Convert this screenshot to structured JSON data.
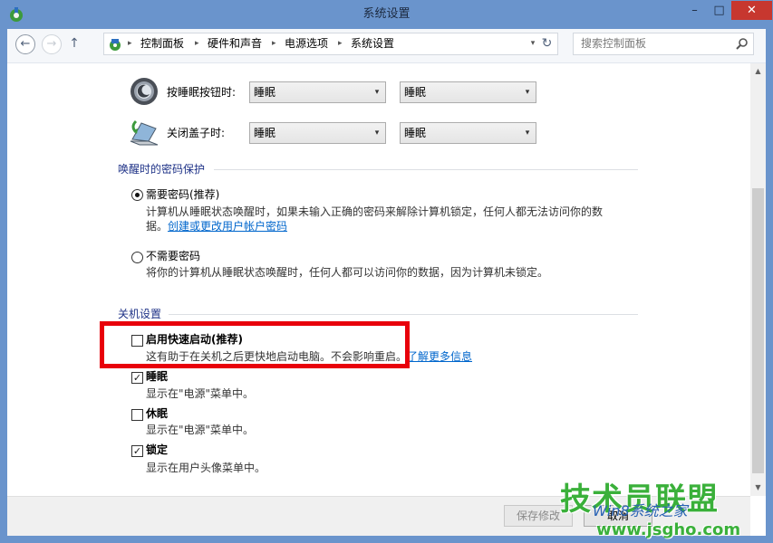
{
  "window": {
    "title": "系统设置",
    "controls": {
      "minimize": "–",
      "maximize": "□",
      "close": "✕"
    }
  },
  "nav": {
    "back_glyph": "←",
    "forward_glyph": "→",
    "up_glyph": "↑",
    "breadcrumb": [
      {
        "label": "控制面板"
      },
      {
        "label": "硬件和声音"
      },
      {
        "label": "电源选项"
      },
      {
        "label": "系统设置"
      }
    ],
    "separator": "▸",
    "dropdown_glyph": "▾",
    "refresh_glyph": "↻",
    "search": {
      "placeholder": "搜索控制面板"
    }
  },
  "power_buttons": [
    {
      "label": "按睡眠按钮时:",
      "battery_value": "睡眠",
      "plugged_value": "睡眠",
      "icon": "sleep-button-icon"
    },
    {
      "label": "关闭盖子时:",
      "battery_value": "睡眠",
      "plugged_value": "睡眠",
      "icon": "laptop-lid-icon"
    }
  ],
  "password": {
    "group_title": "唤醒时的密码保护",
    "require": {
      "label": "需要密码(推荐)",
      "desc": "计算机从睡眠状态唤醒时，如果未输入正确的密码来解除计算机锁定，任何人都无法访问你的数",
      "desc_line2": "据。",
      "link": "创建或更改用户帐户密码",
      "checked": true
    },
    "norequire": {
      "label": "不需要密码",
      "desc": "将你的计算机从睡眠状态唤醒时，任何人都可以访问你的数据，因为计算机未锁定。",
      "checked": false
    }
  },
  "shutdown": {
    "group_title": "关机设置",
    "items": [
      {
        "label": "启用快速启动(推荐)",
        "desc": "这有助于在关机之后更快地启动电脑。不会影响重启。",
        "link": "了解更多信息",
        "checked": false
      },
      {
        "label": "睡眠",
        "desc": "显示在\"电源\"菜单中。",
        "checked": true
      },
      {
        "label": "休眠",
        "desc": "显示在\"电源\"菜单中。",
        "checked": false
      },
      {
        "label": "锁定",
        "desc": "显示在用户头像菜单中。",
        "checked": true
      }
    ]
  },
  "footer": {
    "save_label": "保存修改",
    "cancel_label": "取消"
  },
  "watermark": {
    "main": "技术员联盟",
    "sub": "Win8系统之家",
    "url": "www.jsgho.com"
  },
  "colors": {
    "window_frame": "#6a94cc",
    "close_button": "#c7372f",
    "group_title": "#1e3287",
    "link": "#0066cc",
    "highlight_box": "#e8000b",
    "watermark_green": "#3ab03a"
  }
}
